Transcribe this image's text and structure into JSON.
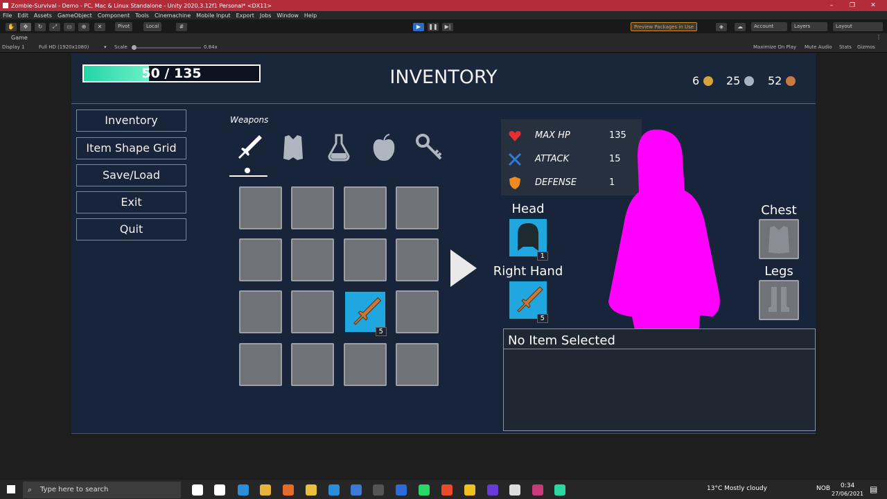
{
  "window": {
    "title": "Zombie-Survival - Demo - PC, Mac & Linux Standalone - Unity 2020.3.12f1 Personal* <DX11>"
  },
  "menu": [
    "File",
    "Edit",
    "Assets",
    "GameObject",
    "Component",
    "Tools",
    "Cinemachine",
    "Mobile Input",
    "Export",
    "Jobs",
    "Window",
    "Help"
  ],
  "toolbar": {
    "pivot": "Pivot",
    "local": "Local",
    "preview_packages": "Preview Packages in Use",
    "account": "Account",
    "layers": "Layers",
    "layout": "Layout"
  },
  "game_tab": {
    "label": "Game"
  },
  "game_bar": {
    "display": "Display 1",
    "resolution": "Full HD (1920x1080)",
    "scale_label": "Scale",
    "scale_value": "0.84x",
    "maximize": "Maximize On Play",
    "mute": "Mute Audio",
    "stats": "Stats",
    "gizmos": "Gizmos"
  },
  "hud": {
    "hp_text": "50 / 135",
    "hp_fraction": 0.37,
    "title": "INVENTORY",
    "currency": [
      {
        "amount": "6",
        "color": "#d6a33a"
      },
      {
        "amount": "25",
        "color": "#a8b4c2"
      },
      {
        "amount": "52",
        "color": "#c87b3e"
      }
    ]
  },
  "side_menu": [
    "Inventory",
    "Item Shape Grid",
    "Save/Load",
    "Exit",
    "Quit"
  ],
  "categories": {
    "active_label": "Weapons",
    "icons": [
      "sword-icon",
      "armor-icon",
      "potion-icon",
      "apple-icon",
      "key-icon"
    ]
  },
  "grid": {
    "slots": [
      {
        "count": ""
      },
      {
        "count": ""
      },
      {
        "count": ""
      },
      {
        "count": ""
      },
      {
        "count": ""
      },
      {
        "count": ""
      },
      {
        "count": ""
      },
      {
        "count": ""
      },
      {
        "count": ""
      },
      {
        "count": ""
      },
      {
        "count": "5",
        "item": "sword"
      },
      {
        "count": ""
      },
      {
        "count": ""
      },
      {
        "count": ""
      },
      {
        "count": ""
      },
      {
        "count": ""
      }
    ]
  },
  "stats": [
    {
      "name": "MAX HP",
      "value": "135",
      "icon": "heart-icon",
      "color": "#e53030"
    },
    {
      "name": "ATTACK",
      "value": "15",
      "icon": "crossed-swords-icon",
      "color": "#2f7bd8"
    },
    {
      "name": "DEFENSE",
      "value": "1",
      "icon": "shield-icon",
      "color": "#f08a1c"
    }
  ],
  "equipment": {
    "head": {
      "label": "Head",
      "count": "1"
    },
    "right_hand": {
      "label": "Right Hand",
      "count": "5"
    },
    "chest": {
      "label": "Chest"
    },
    "legs": {
      "label": "Legs"
    }
  },
  "detail": {
    "title": "No Item Selected"
  },
  "taskbar": {
    "search_placeholder": "Type here to search",
    "weather": "13°C  Mostly cloudy",
    "lang": "NOB",
    "time": "0:34",
    "date": "27/06/2021"
  }
}
